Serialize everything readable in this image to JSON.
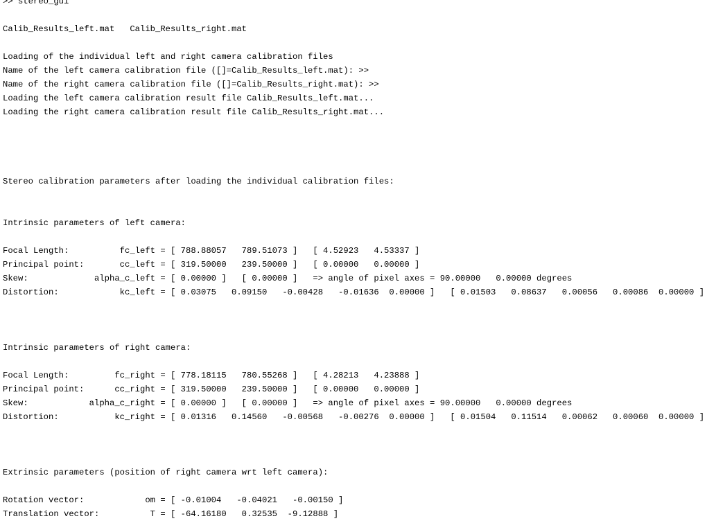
{
  "window": {
    "app": "MATLAB",
    "panel": "Command Window",
    "background_color": "#ffffff",
    "text_color": "#000000",
    "font_size_px": 12
  },
  "console": {
    "prompt_symbol": ">>",
    "lines": [
      {
        "id": "clipped-top",
        "text": "....",
        "kind": "clipped"
      },
      {
        "id": "command-prompt",
        "text": ">> stereo_gui",
        "kind": "command"
      },
      {
        "id": "blank-1",
        "text": "",
        "kind": "blank"
      },
      {
        "id": "mat-files",
        "text": "Calib_Results_left.mat   Calib_Results_right.mat",
        "kind": "output"
      },
      {
        "id": "blank-2",
        "text": "",
        "kind": "blank"
      },
      {
        "id": "loading-header",
        "text": "Loading of the individual left and right camera calibration files",
        "kind": "output"
      },
      {
        "id": "name-left-file",
        "text": "Name of the left camera calibration file ([]=Calib_Results_left.mat): >>",
        "kind": "output"
      },
      {
        "id": "name-right-file",
        "text": "Name of the right camera calibration file ([]=Calib_Results_right.mat): >>",
        "kind": "output"
      },
      {
        "id": "loading-left",
        "text": "Loading the left camera calibration result file Calib_Results_left.mat...",
        "kind": "output"
      },
      {
        "id": "loading-right",
        "text": "Loading the right camera calibration result file Calib_Results_right.mat...",
        "kind": "output"
      },
      {
        "id": "blank-3",
        "text": "",
        "kind": "blank"
      },
      {
        "id": "blank-4",
        "text": "",
        "kind": "blank"
      },
      {
        "id": "blank-5",
        "text": "",
        "kind": "blank"
      },
      {
        "id": "blank-6",
        "text": "",
        "kind": "blank"
      },
      {
        "id": "stereo-header",
        "text": "Stereo calibration parameters after loading the individual calibration files:",
        "kind": "output"
      },
      {
        "id": "blank-7",
        "text": "",
        "kind": "blank"
      },
      {
        "id": "blank-8",
        "text": "",
        "kind": "blank"
      },
      {
        "id": "intrinsic-left-hdr",
        "text": "Intrinsic parameters of left camera:",
        "kind": "output"
      },
      {
        "id": "blank-9",
        "text": "",
        "kind": "blank"
      },
      {
        "id": "fc-left",
        "text": "Focal Length:          fc_left = [ 788.88057   789.51073 ]   [ 4.52923   4.53337 ]",
        "kind": "output"
      },
      {
        "id": "cc-left",
        "text": "Principal point:       cc_left = [ 319.50000   239.50000 ]   [ 0.00000   0.00000 ]",
        "kind": "output"
      },
      {
        "id": "alpha-c-left",
        "text": "Skew:             alpha_c_left = [ 0.00000 ]   [ 0.00000 ]   => angle of pixel axes = 90.00000   0.00000 degrees",
        "kind": "output"
      },
      {
        "id": "kc-left",
        "text": "Distortion:            kc_left = [ 0.03075   0.09150   -0.00428   -0.01636  0.00000 ]   [ 0.01503   0.08637   0.00056   0.00086  0.00000 ]",
        "kind": "output"
      },
      {
        "id": "blank-10",
        "text": "",
        "kind": "blank"
      },
      {
        "id": "blank-11",
        "text": "",
        "kind": "blank"
      },
      {
        "id": "blank-12",
        "text": "",
        "kind": "blank"
      },
      {
        "id": "intrinsic-right-hdr",
        "text": "Intrinsic parameters of right camera:",
        "kind": "output"
      },
      {
        "id": "blank-13",
        "text": "",
        "kind": "blank"
      },
      {
        "id": "fc-right",
        "text": "Focal Length:         fc_right = [ 778.18115   780.55268 ]   [ 4.28213   4.23888 ]",
        "kind": "output"
      },
      {
        "id": "cc-right",
        "text": "Principal point:      cc_right = [ 319.50000   239.50000 ]   [ 0.00000   0.00000 ]",
        "kind": "output"
      },
      {
        "id": "alpha-c-right",
        "text": "Skew:            alpha_c_right = [ 0.00000 ]   [ 0.00000 ]   => angle of pixel axes = 90.00000   0.00000 degrees",
        "kind": "output"
      },
      {
        "id": "kc-right",
        "text": "Distortion:           kc_right = [ 0.01316   0.14560   -0.00568   -0.00276  0.00000 ]   [ 0.01504   0.11514   0.00062   0.00060  0.00000 ]",
        "kind": "output"
      },
      {
        "id": "blank-14",
        "text": "",
        "kind": "blank"
      },
      {
        "id": "blank-15",
        "text": "",
        "kind": "blank"
      },
      {
        "id": "blank-16",
        "text": "",
        "kind": "blank"
      },
      {
        "id": "extrinsic-hdr",
        "text": "Extrinsic parameters (position of right camera wrt left camera):",
        "kind": "output"
      },
      {
        "id": "blank-17",
        "text": "",
        "kind": "blank"
      },
      {
        "id": "om-vector",
        "text": "Rotation vector:            om = [ -0.01004   -0.04021   -0.00150 ]",
        "kind": "output"
      },
      {
        "id": "t-vector",
        "text": "Translation vector:          T = [ -64.16180   0.32535  -9.12888 ]",
        "kind": "output"
      }
    ]
  },
  "calibration": {
    "command": "stereo_gui",
    "files": {
      "left": "Calib_Results_left.mat",
      "right": "Calib_Results_right.mat"
    },
    "left_camera": {
      "focal_length": {
        "symbol": "fc_left",
        "values": [
          788.88057,
          789.51073
        ],
        "uncertainty": [
          4.52923,
          4.53337
        ]
      },
      "principal_point": {
        "symbol": "cc_left",
        "values": [
          319.5,
          239.5
        ],
        "uncertainty": [
          0.0,
          0.0
        ]
      },
      "skew": {
        "symbol": "alpha_c_left",
        "values": [
          0.0
        ],
        "uncertainty": [
          0.0
        ],
        "pixel_axes_angle_deg": 90.0,
        "pixel_axes_angle_uncertainty": 0.0
      },
      "distortion": {
        "symbol": "kc_left",
        "values": [
          0.03075,
          0.0915,
          -0.00428,
          -0.01636,
          0.0
        ],
        "uncertainty": [
          0.01503,
          0.08637,
          0.00056,
          0.00086,
          0.0
        ]
      }
    },
    "right_camera": {
      "focal_length": {
        "symbol": "fc_right",
        "values": [
          778.18115,
          780.55268
        ],
        "uncertainty": [
          4.28213,
          4.23888
        ]
      },
      "principal_point": {
        "symbol": "cc_right",
        "values": [
          319.5,
          239.5
        ],
        "uncertainty": [
          0.0,
          0.0
        ]
      },
      "skew": {
        "symbol": "alpha_c_right",
        "values": [
          0.0
        ],
        "uncertainty": [
          0.0
        ],
        "pixel_axes_angle_deg": 90.0,
        "pixel_axes_angle_uncertainty": 0.0
      },
      "distortion": {
        "symbol": "kc_right",
        "values": [
          0.01316,
          0.1456,
          -0.00568,
          -0.00276,
          0.0
        ],
        "uncertainty": [
          0.01504,
          0.11514,
          0.00062,
          0.0006,
          0.0
        ]
      }
    },
    "extrinsics": {
      "description": "position of right camera wrt left camera",
      "rotation_vector": {
        "symbol": "om",
        "values": [
          -0.01004,
          -0.04021,
          -0.0015
        ]
      },
      "translation_vector": {
        "symbol": "T",
        "values": [
          -64.1618,
          0.32535,
          -9.12888
        ]
      }
    }
  }
}
